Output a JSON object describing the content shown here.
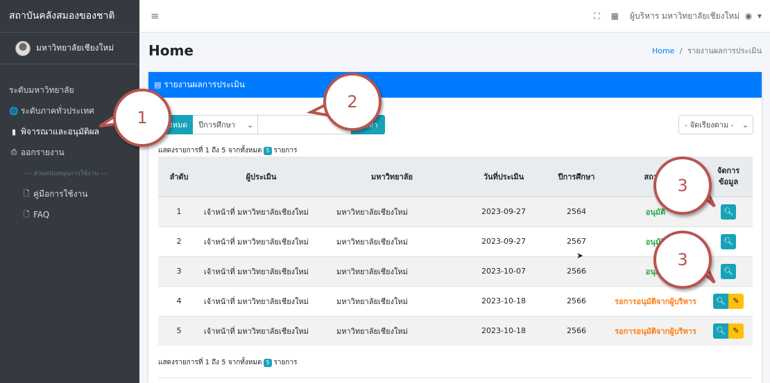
{
  "sidebar": {
    "brand": "สถาบันคลังสมองของชาติ",
    "user": "มหาวิทยาลัยเชียงใหม่",
    "items": [
      {
        "label": "ระดับมหาวิทยาลัย",
        "icon": ""
      },
      {
        "label": "ระดับภาคทั่วประเทศ",
        "icon": "globe-icon"
      },
      {
        "label": "พิจารณาและอนุมัติผล",
        "icon": "clipboard-icon"
      },
      {
        "label": "ออกรายงาน",
        "icon": "print-icon"
      }
    ],
    "section_header": "--- ส่วนสนับสนุนการใช้งาน ---",
    "support": [
      {
        "label": "คู่มือการใช้งาน",
        "icon": "file-icon"
      },
      {
        "label": "FAQ",
        "icon": "file-icon"
      }
    ]
  },
  "topbar": {
    "user_label": "ผู้บริหาร มหาวิทยาลัยเชียงใหม่"
  },
  "header": {
    "title": "Home",
    "breadcrumb_home": "Home",
    "breadcrumb_sep": "/",
    "breadcrumb_current": "รายงานผลการประเมิน"
  },
  "card": {
    "title": "รายงานผลการประเมิน",
    "btn_all": "ทั้งหมด",
    "year_select": "ปีการศึกษา",
    "search_placeholder": "",
    "btn_search": "ค้นหา",
    "sort_select": "- จัดเรียงตาม -",
    "info_top_prefix": "แสดงรายการที่ 1 ถึง 5 จากทั้งหมด",
    "info_count": "5",
    "info_suffix": "รายการ",
    "info_bottom_prefix": "แสดงรายการที่ 1 ถึง 5 จากทั้งหมด"
  },
  "table": {
    "headers": [
      "ลำดับ",
      "ผู้ประเมิน",
      "มหาวิทยาลัย",
      "วันที่ประเมิน",
      "ปีการศึกษา",
      "สถานะ",
      "จัดการข้อมูล"
    ],
    "rows": [
      {
        "no": "1",
        "assessor": "เจ้าหน้าที่ มหาวิทยาลัยเชียงใหม่",
        "university": "มหาวิทยาลัยเชียงใหม่",
        "date": "2023-09-27",
        "year": "2564",
        "status": "อนุมัติ",
        "status_type": "ok"
      },
      {
        "no": "2",
        "assessor": "เจ้าหน้าที่ มหาวิทยาลัยเชียงใหม่",
        "university": "มหาวิทยาลัยเชียงใหม่",
        "date": "2023-09-27",
        "year": "2567",
        "status": "อนุมัติ",
        "status_type": "ok"
      },
      {
        "no": "3",
        "assessor": "เจ้าหน้าที่ มหาวิทยาลัยเชียงใหม่",
        "university": "มหาวิทยาลัยเชียงใหม่",
        "date": "2023-10-07",
        "year": "2566",
        "status": "อนุมัติ",
        "status_type": "ok"
      },
      {
        "no": "4",
        "assessor": "เจ้าหน้าที่ มหาวิทยาลัยเชียงใหม่",
        "university": "มหาวิทยาลัยเชียงใหม่",
        "date": "2023-10-18",
        "year": "2566",
        "status": "รอการอนุมัติจากผู้บริหาร",
        "status_type": "wait"
      },
      {
        "no": "5",
        "assessor": "เจ้าหน้าที่ มหาวิทยาลัยเชียงใหม่",
        "university": "มหาวิทยาลัยเชียงใหม่",
        "date": "2023-10-18",
        "year": "2566",
        "status": "รอการอนุมัติจากผู้บริหาร",
        "status_type": "wait"
      }
    ]
  },
  "callouts": [
    "1",
    "2",
    "3",
    "3"
  ],
  "colors": {
    "primary": "#007bff",
    "info": "#17a2b8",
    "success": "#28a745",
    "warning": "#fd7e14",
    "sidebar": "#343a40",
    "callout": "#b85450"
  }
}
